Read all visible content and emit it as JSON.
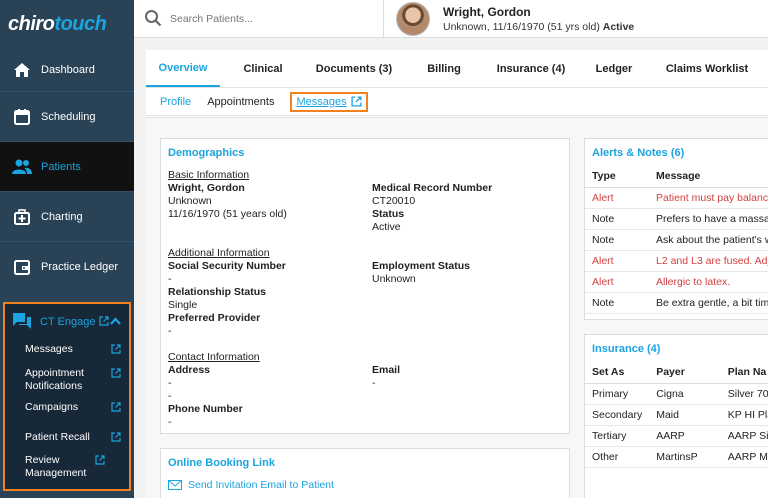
{
  "app": {
    "logo_part1": "chiro",
    "logo_part2": "touch"
  },
  "sidebar": {
    "items": [
      {
        "label": "Dashboard",
        "icon": "home-icon"
      },
      {
        "label": "Scheduling",
        "icon": "calendar-icon"
      },
      {
        "label": "Patients",
        "icon": "people-icon",
        "active": true
      },
      {
        "label": "Charting",
        "icon": "medical-kit-icon"
      },
      {
        "label": "Practice Ledger",
        "icon": "wallet-icon"
      }
    ],
    "engage": {
      "label": "CT Engage",
      "sub_items": [
        {
          "label": "Messages"
        },
        {
          "label": "Appointment Notifications"
        },
        {
          "label": "Campaigns"
        },
        {
          "label": "Patient Recall"
        },
        {
          "label": "Review Management"
        }
      ]
    }
  },
  "search": {
    "placeholder": "Search Patients..."
  },
  "patient": {
    "name": "Wright, Gordon",
    "details": "Unknown, 11/16/1970 (51 yrs old)",
    "status": "Active"
  },
  "tabs": [
    "Overview",
    "Clinical",
    "Documents (3)",
    "Billing",
    "Insurance (4)",
    "Ledger",
    "Claims Worklist"
  ],
  "subtabs": [
    "Profile",
    "Appointments",
    "Messages"
  ],
  "demographics": {
    "title": "Demographics",
    "basic_info": "Basic Information",
    "name": "Wright, Gordon",
    "gender": "Unknown",
    "dob": "11/16/1970 (51 years old)",
    "mrn_label": "Medical Record Number",
    "mrn": "CT20010",
    "status_label": "Status",
    "status": "Active",
    "additional_info": "Additional Information",
    "ssn_label": "Social Security Number",
    "ssn": "-",
    "employment_label": "Employment Status",
    "employment": "Unknown",
    "relationship_label": "Relationship Status",
    "relationship": "Single",
    "provider_label": "Preferred Provider",
    "provider": "-",
    "contact_info": "Contact Information",
    "address_label": "Address",
    "address1": "-",
    "address2": "-",
    "email_label": "Email",
    "email": "-",
    "phone_label": "Phone Number",
    "phone": "-"
  },
  "booking": {
    "title": "Online Booking Link",
    "link": "Send Invitation Email to Patient"
  },
  "alerts": {
    "title": "Alerts & Notes (6)",
    "headers": [
      "Type",
      "Message"
    ],
    "rows": [
      {
        "type": "Alert",
        "message": "Patient must pay balance",
        "alert": true
      },
      {
        "type": "Note",
        "message": "Prefers to have a massag",
        "alert": false
      },
      {
        "type": "Note",
        "message": "Ask about the patient's w",
        "alert": false
      },
      {
        "type": "Alert",
        "message": "L2 and L3 are fused. Adju",
        "alert": true
      },
      {
        "type": "Alert",
        "message": "Allergic to latex.",
        "alert": true
      },
      {
        "type": "Note",
        "message": "Be extra gentle, a bit timi",
        "alert": false
      }
    ]
  },
  "insurance": {
    "title": "Insurance (4)",
    "headers": [
      "Set As",
      "Payer",
      "Plan Na"
    ],
    "rows": [
      {
        "set_as": "Primary",
        "payer": "Cigna",
        "plan": "Silver 70"
      },
      {
        "set_as": "Secondary",
        "payer": "Maid",
        "plan": "KP HI Pla"
      },
      {
        "set_as": "Tertiary",
        "payer": "AARP",
        "plan": "AARP Silv"
      },
      {
        "set_as": "Other",
        "payer": "MartinsP",
        "plan": "AARP Me"
      }
    ]
  },
  "colors": {
    "accent": "#1aa4e0",
    "sidebar": "#2a4255",
    "highlight": "#f08020",
    "alert": "#d04040"
  }
}
